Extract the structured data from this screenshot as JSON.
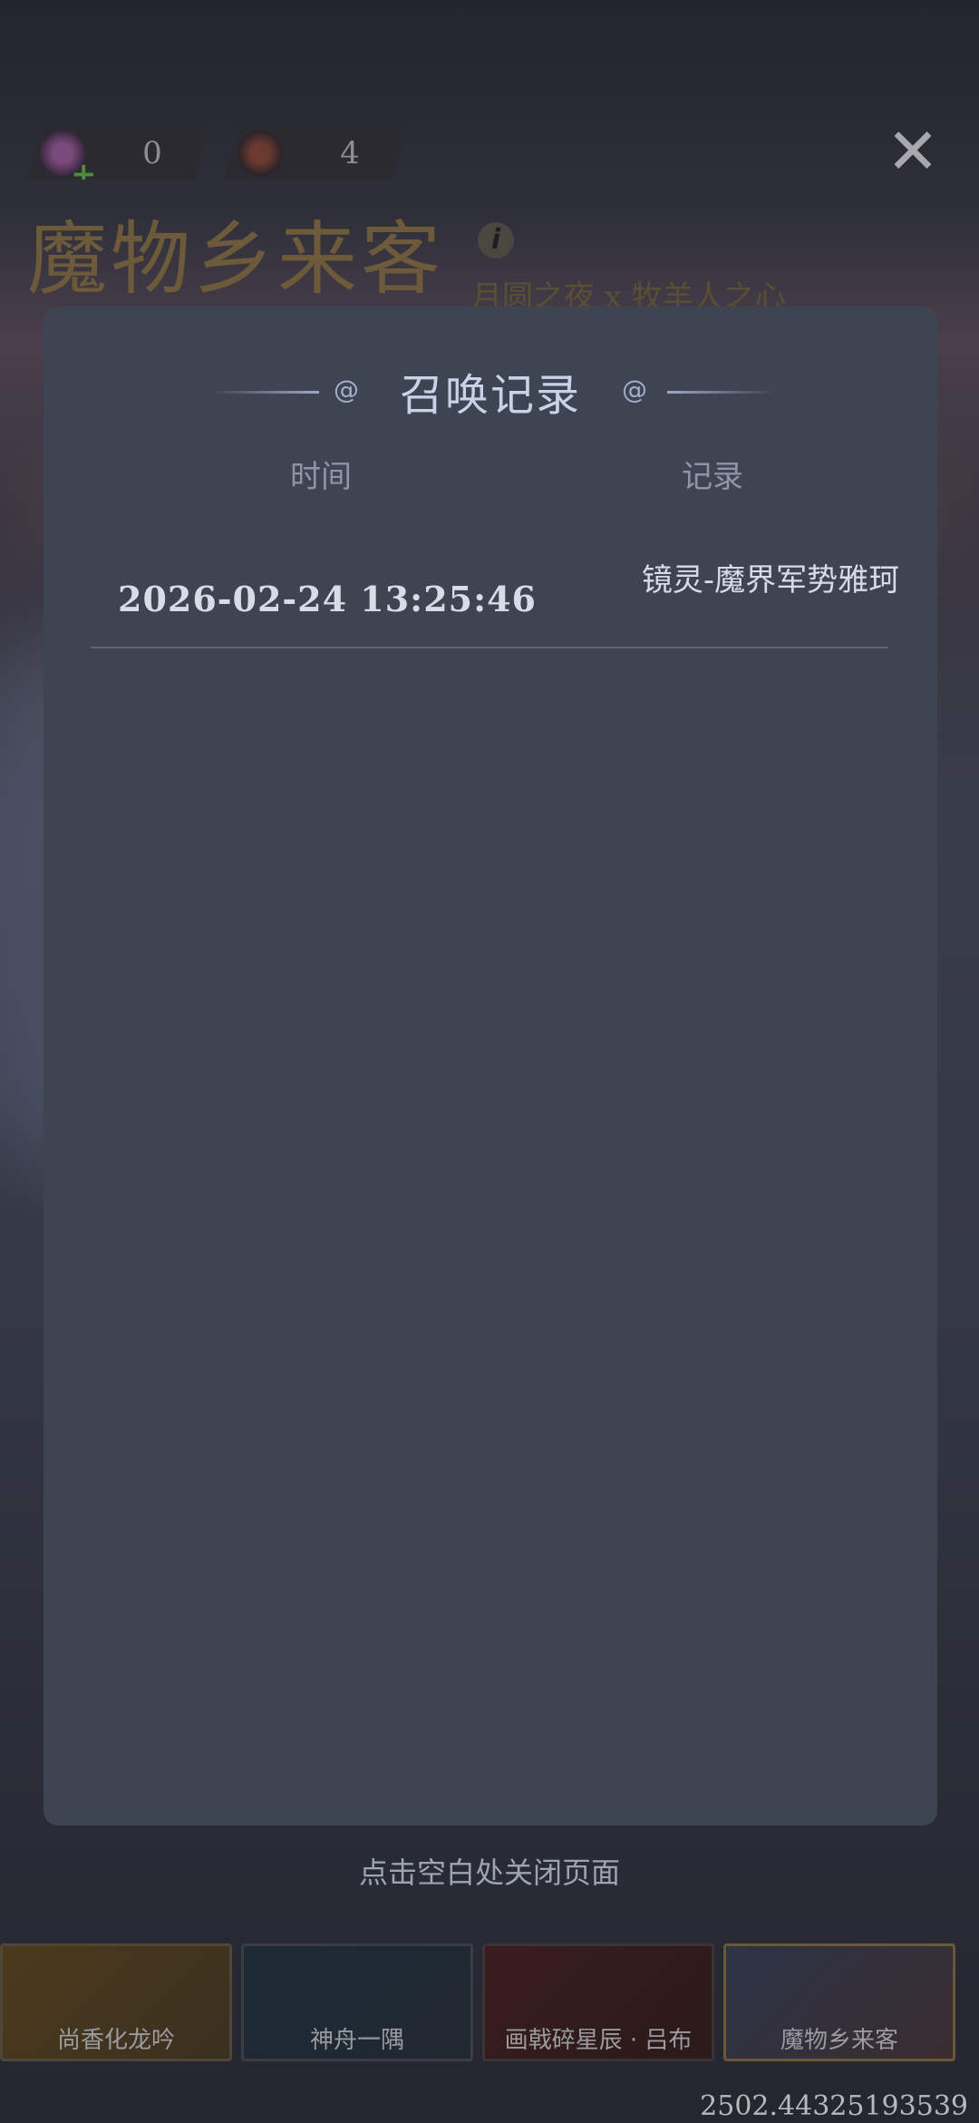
{
  "currencies": [
    {
      "icon": "candy-icon",
      "value": "0"
    },
    {
      "icon": "demon-horn-icon",
      "value": "4"
    }
  ],
  "event": {
    "title": "魔物乡来客",
    "subtitle": "月圆之夜 x 牧羊人之心"
  },
  "dialog": {
    "title": "召唤记录",
    "columns": {
      "time": "时间",
      "record": "记录"
    },
    "rows": [
      {
        "time": "2026-02-24 13:25:46",
        "record": "镜灵-魔界军势雅珂"
      }
    ]
  },
  "hint": "点击空白处关闭页面",
  "tabs": [
    {
      "label": "尚香化龙吟"
    },
    {
      "label": "神舟一隅"
    },
    {
      "label": "画戟碎星辰 · 吕布"
    },
    {
      "label": "魔物乡来客"
    }
  ],
  "coord_readout": "2502.44325193539"
}
